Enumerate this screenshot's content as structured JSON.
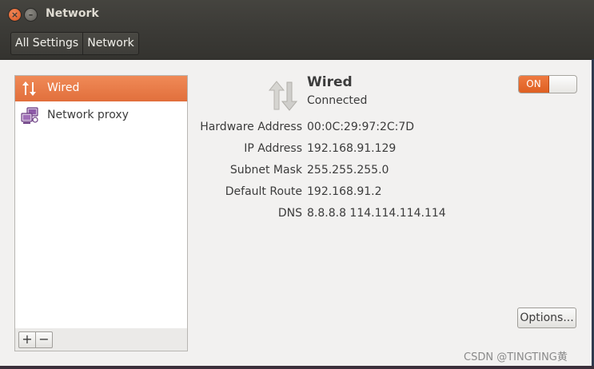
{
  "window": {
    "title": "Network",
    "close_glyph": "×",
    "minimize_glyph": "–"
  },
  "toolbar": {
    "breadcrumb": [
      "All Settings",
      "Network"
    ]
  },
  "sidebar": {
    "items": [
      {
        "label": "Wired",
        "icon": "wired-arrows-icon",
        "selected": true
      },
      {
        "label": "Network proxy",
        "icon": "network-proxy-icon",
        "selected": false
      }
    ],
    "add_label": "+",
    "remove_label": "−"
  },
  "device": {
    "name": "Wired",
    "status": "Connected",
    "switch_label": "ON",
    "switch_state": "on"
  },
  "details": [
    {
      "label": "Hardware Address",
      "value": "00:0C:29:97:2C:7D"
    },
    {
      "label": "IP Address",
      "value": "192.168.91.129"
    },
    {
      "label": "Subnet Mask",
      "value": "255.255.255.0"
    },
    {
      "label": "Default Route",
      "value": "192.168.91.2"
    },
    {
      "label": "DNS",
      "value": "8.8.8.8 114.114.114.114"
    }
  ],
  "options_label": "Options...",
  "watermark": "CSDN @TINGTING黄",
  "colors": {
    "accent": "#e16f3c",
    "titlebar": "#3c3b37",
    "background": "#f2f1f0"
  }
}
